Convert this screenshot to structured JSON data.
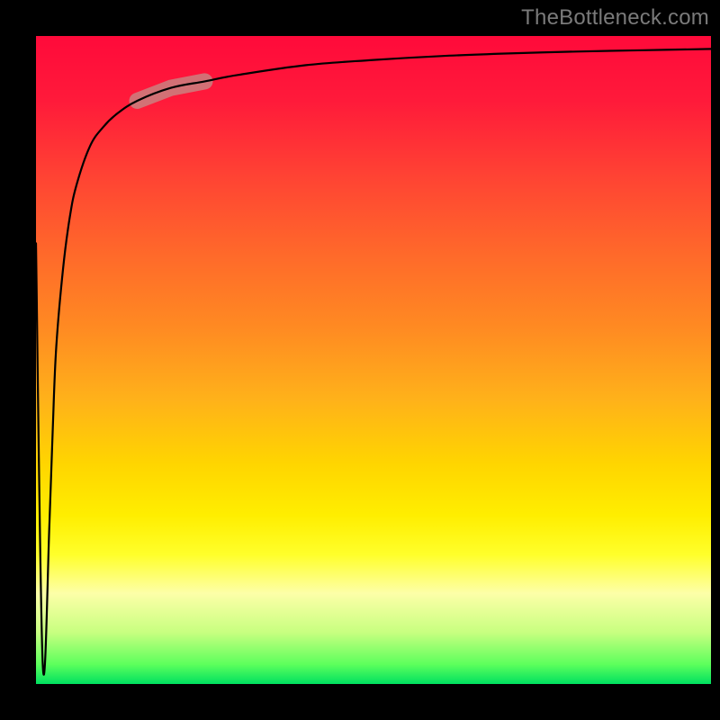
{
  "watermark": "TheBottleneck.com",
  "colors": {
    "gradient_top": "#ff0a3a",
    "gradient_mid": "#ffd500",
    "gradient_bottom": "#00e060",
    "curve": "#000000",
    "highlight": "#c58a86",
    "frame": "#000000"
  },
  "chart_data": {
    "type": "line",
    "title": "",
    "xlabel": "",
    "ylabel": "",
    "xlim": [
      0,
      100
    ],
    "ylim": [
      0,
      100
    ],
    "series": [
      {
        "name": "bottleneck-curve",
        "x": [
          0,
          1,
          2,
          2.5,
          3,
          4,
          5,
          6,
          8,
          10,
          12,
          15,
          20,
          25,
          30,
          40,
          50,
          60,
          70,
          80,
          90,
          100
        ],
        "y": [
          68,
          3,
          25,
          40,
          52,
          64,
          72,
          77,
          83,
          86,
          88,
          90,
          92,
          93,
          94,
          95.5,
          96.3,
          96.9,
          97.3,
          97.6,
          97.8,
          98
        ]
      }
    ],
    "annotations": [
      {
        "name": "highlight-segment",
        "x_range": [
          15,
          25
        ],
        "note": "thick pale segment on rising curve"
      }
    ],
    "background_gradient": {
      "orientation": "vertical",
      "stops": [
        {
          "pos": 0.0,
          "color": "#ff0a3a"
        },
        {
          "pos": 0.45,
          "color": "#ff8a22"
        },
        {
          "pos": 0.74,
          "color": "#ffee00"
        },
        {
          "pos": 0.97,
          "color": "#5cff5c"
        },
        {
          "pos": 1.0,
          "color": "#00e060"
        }
      ]
    }
  }
}
